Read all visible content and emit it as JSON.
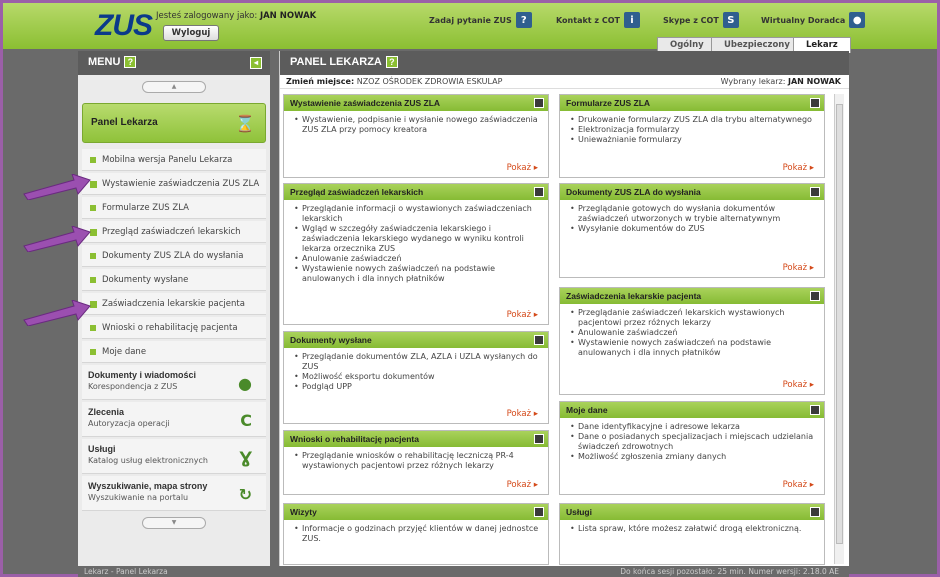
{
  "header": {
    "logo": "ZUS",
    "logged_prefix": "Jesteś zalogowany jako:",
    "user": "JAN NOWAK",
    "logout": "Wyloguj",
    "links": [
      {
        "label": "Zadaj pytanie ZUS",
        "icon": "question-icon"
      },
      {
        "label": "Kontakt z COT",
        "icon": "info-icon"
      },
      {
        "label": "Skype z COT",
        "icon": "skype-icon"
      },
      {
        "label": "Wirtualny Doradca",
        "icon": "person-icon"
      }
    ],
    "tabs": [
      {
        "label": "Ogólny"
      },
      {
        "label": "Ubezpieczony"
      },
      {
        "label": "Lekarz"
      }
    ]
  },
  "sidebar": {
    "title": "MENU",
    "panel_title": "Panel Lekarza",
    "items": [
      {
        "label": "Mobilna wersja Panelu Lekarza"
      },
      {
        "label": "Wystawienie zaświadczenia ZUS ZLA"
      },
      {
        "label": "Formularze ZUS ZLA"
      },
      {
        "label": "Przegląd zaświadczeń lekarskich"
      },
      {
        "label": "Dokumenty ZUS ZLA do wysłania"
      },
      {
        "label": "Dokumenty wysłane"
      },
      {
        "label": "Zaświadczenia lekarskie pacjenta"
      },
      {
        "label": "Wnioski o rehabilitację pacjenta"
      },
      {
        "label": "Moje dane"
      }
    ],
    "groups": [
      {
        "title": "Dokumenty i wiadomości",
        "sub": "Korespondencja z ZUS",
        "icon": "speech-bubble-icon"
      },
      {
        "title": "Zlecenia",
        "sub": "Autoryzacja operacji",
        "icon": "refresh-c-icon"
      },
      {
        "title": "Usługi",
        "sub": "Katalog usług elektronicznych",
        "icon": "network-icon"
      },
      {
        "title": "Wyszukiwanie, mapa strony",
        "sub": "Wyszukiwanie na portalu",
        "icon": "sync-icon"
      }
    ]
  },
  "main": {
    "title": "PANEL LEKARZA",
    "change_place_label": "Zmień miejsce:",
    "place": "NZOZ OŚRODEK ZDROWIA ESKULAP",
    "doctor_label": "Wybrany lekarz:",
    "doctor": "JAN NOWAK",
    "more": "Pokaż",
    "cards": [
      {
        "title": "Wystawienie zaświadczenia ZUS ZLA",
        "items": [
          "Wystawienie, podpisanie i wysłanie nowego zaświadczenia ZUS ZLA przy pomocy kreatora"
        ]
      },
      {
        "title": "Formularze ZUS ZLA",
        "items": [
          "Drukowanie formularzy ZUS ZLA dla trybu alternatywnego",
          "Elektronizacja formularzy",
          "Unieważnianie formularzy"
        ]
      },
      {
        "title": "Przegląd zaświadczeń lekarskich",
        "items": [
          "Przeglądanie informacji o wystawionych zaświadczeniach lekarskich",
          "Wgląd w szczegóły zaświadczenia lekarskiego i zaświadczenia lekarskiego wydanego w wyniku kontroli lekarza orzecznika ZUS",
          "Anulowanie zaświadczeń",
          "Wystawienie nowych zaświadczeń na podstawie anulowanych i dla innych płatników"
        ]
      },
      {
        "title": "Dokumenty ZUS ZLA do wysłania",
        "items": [
          "Przeglądanie gotowych do wysłania dokumentów zaświadczeń utworzonych w trybie alternatywnym",
          "Wysyłanie dokumentów do ZUS"
        ]
      },
      {
        "title": "Zaświadczenia lekarskie pacjenta",
        "items": [
          "Przeglądanie zaświadczeń lekarskich wystawionych pacjentowi przez różnych lekarzy",
          "Anulowanie zaświadczeń",
          "Wystawienie nowych zaświadczeń na podstawie anulowanych i dla innych płatników"
        ]
      },
      {
        "title": "Dokumenty wysłane",
        "items": [
          "Przeglądanie dokumentów ZLA, AZLA i UZLA wysłanych do ZUS",
          "Możliwość eksportu dokumentów",
          "Podgląd UPP"
        ]
      },
      {
        "title": "Moje dane",
        "items": [
          "Dane identyfikacyjne i adresowe lekarza",
          "Dane o posiadanych specjalizacjach i miejscach udzielania świadczeń zdrowotnych",
          "Możliwość zgłoszenia zmiany danych"
        ]
      },
      {
        "title": "Wnioski o rehabilitację pacjenta",
        "items": [
          "Przeglądanie wniosków o rehabilitację leczniczą PR-4 wystawionych pacjentowi przez różnych lekarzy"
        ]
      },
      {
        "title": "Wizyty",
        "items": [
          "Informacje o godzinach przyjęć klientów w danej jednostce ZUS."
        ]
      },
      {
        "title": "Usługi",
        "items": [
          "Lista spraw, które możesz załatwić drogą elektroniczną."
        ]
      }
    ]
  },
  "status": {
    "left": "Lekarz - Panel Lekarza",
    "right": "Do końca sesji pozostało: 25 min.   Numer wersji: 2.18.0 AE"
  },
  "colors": {
    "accent": "#8bbf32",
    "frame": "#9b5fa8",
    "dark": "#5c5c5c",
    "more_link": "#d44a1a"
  }
}
